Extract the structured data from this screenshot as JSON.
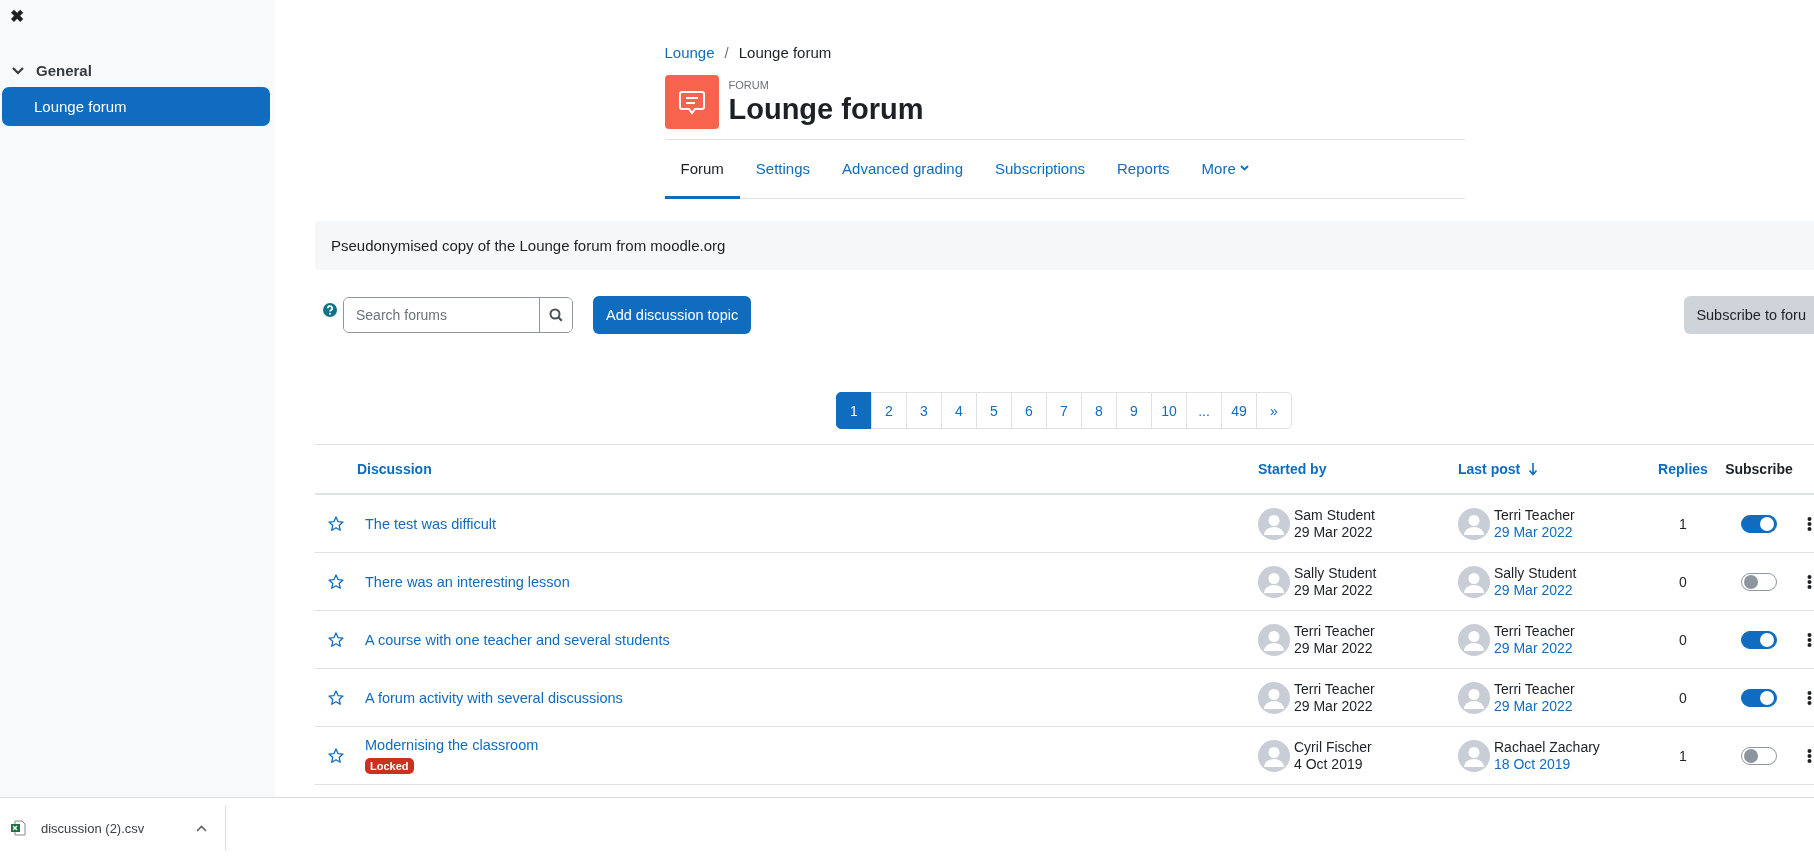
{
  "sidebar": {
    "close_icon": "✖",
    "section": {
      "label": "General",
      "expanded": true
    },
    "items": [
      {
        "label": "Lounge forum",
        "selected": true
      }
    ]
  },
  "breadcrumb": {
    "items": [
      "Lounge",
      "Lounge forum"
    ],
    "separator": "/"
  },
  "header": {
    "kicker": "FORUM",
    "title": "Lounge forum"
  },
  "tabs": [
    {
      "label": "Forum",
      "selected": true,
      "kind": "tab"
    },
    {
      "label": "Settings",
      "selected": false,
      "kind": "tab"
    },
    {
      "label": "Advanced grading",
      "selected": false,
      "kind": "tab"
    },
    {
      "label": "Subscriptions",
      "selected": false,
      "kind": "tab"
    },
    {
      "label": "Reports",
      "selected": false,
      "kind": "tab"
    },
    {
      "label": "More",
      "selected": false,
      "kind": "menu"
    }
  ],
  "description": "Pseudonymised copy of the Lounge forum from moodle.org",
  "toolbar": {
    "search": {
      "placeholder": "Search forums"
    },
    "add_button": "Add discussion topic",
    "subscribe_button": "Subscribe to foru"
  },
  "pagination": [
    {
      "label": "1",
      "selected": true
    },
    {
      "label": "2",
      "selected": false
    },
    {
      "label": "3",
      "selected": false
    },
    {
      "label": "4",
      "selected": false
    },
    {
      "label": "5",
      "selected": false
    },
    {
      "label": "6",
      "selected": false
    },
    {
      "label": "7",
      "selected": false
    },
    {
      "label": "8",
      "selected": false
    },
    {
      "label": "9",
      "selected": false
    },
    {
      "label": "10",
      "selected": false
    },
    {
      "label": "...",
      "selected": false
    },
    {
      "label": "49",
      "selected": false
    },
    {
      "label": "»",
      "selected": false
    }
  ],
  "table": {
    "columns": [
      {
        "label": "Discussion",
        "kind": "link",
        "sorted": false
      },
      {
        "label": "Started by",
        "kind": "link",
        "sorted": false
      },
      {
        "label": "Last post",
        "kind": "link",
        "sorted": true
      },
      {
        "label": "Replies",
        "kind": "link",
        "sorted": false
      },
      {
        "label": "Subscribe",
        "kind": "text",
        "sorted": false
      }
    ],
    "rows": [
      {
        "title": "The test was difficult",
        "locked": false,
        "started_by": {
          "name": "Sam Student",
          "date": "29 Mar 2022"
        },
        "last_post": {
          "name": "Terri Teacher",
          "date": "29 Mar 2022"
        },
        "replies": "1",
        "subscribed": true
      },
      {
        "title": "There was an interesting lesson",
        "locked": false,
        "started_by": {
          "name": "Sally Student",
          "date": "29 Mar 2022"
        },
        "last_post": {
          "name": "Sally Student",
          "date": "29 Mar 2022"
        },
        "replies": "0",
        "subscribed": false
      },
      {
        "title": "A course with one teacher and several students",
        "locked": false,
        "started_by": {
          "name": "Terri Teacher",
          "date": "29 Mar 2022"
        },
        "last_post": {
          "name": "Terri Teacher",
          "date": "29 Mar 2022"
        },
        "replies": "0",
        "subscribed": true
      },
      {
        "title": "A forum activity with several discussions",
        "locked": false,
        "started_by": {
          "name": "Terri Teacher",
          "date": "29 Mar 2022"
        },
        "last_post": {
          "name": "Terri Teacher",
          "date": "29 Mar 2022"
        },
        "replies": "0",
        "subscribed": true
      },
      {
        "title": "Modernising the classroom",
        "locked": true,
        "badge": "Locked",
        "started_by": {
          "name": "Cyril Fischer",
          "date": "4 Oct 2019"
        },
        "last_post": {
          "name": "Rachael Zachary",
          "date": "18 Oct 2019"
        },
        "replies": "1",
        "subscribed": false
      }
    ]
  },
  "download_bar": {
    "file": "discussion (2).csv"
  }
}
